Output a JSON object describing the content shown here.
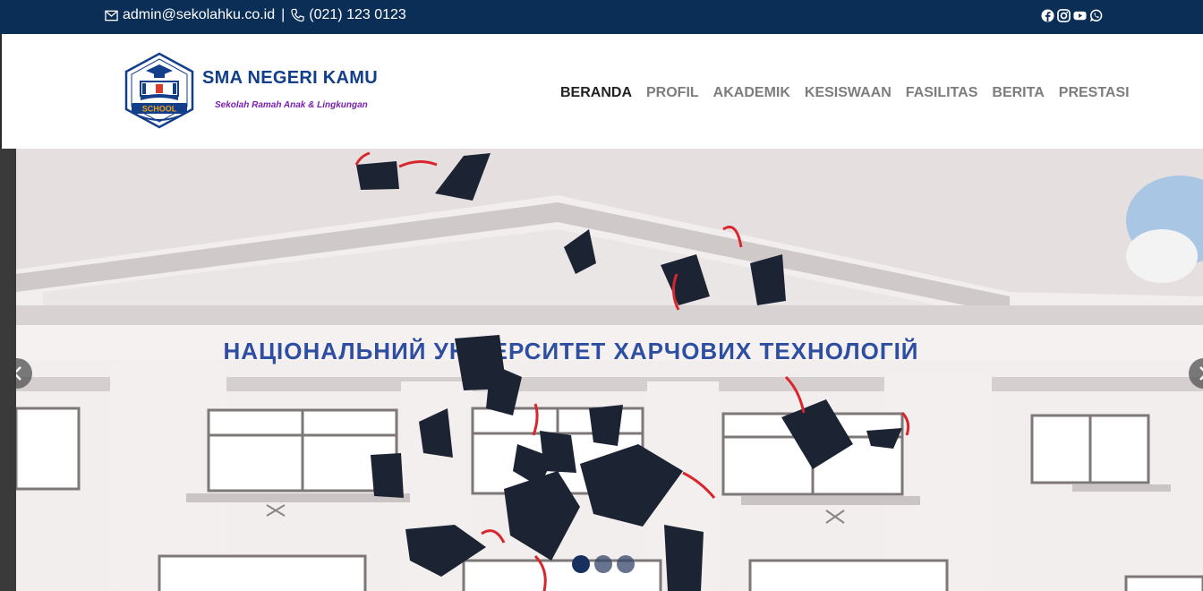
{
  "topbar": {
    "email": "admin@sekolahku.co.id",
    "separator": "|",
    "phone": "(021) 123 0123",
    "social_icons": [
      "facebook-icon",
      "instagram-icon",
      "youtube-icon",
      "whatsapp-icon"
    ]
  },
  "brand": {
    "name": "SMA NEGERI KAMU",
    "tagline": "Sekolah Ramah Anak & Lingkungan",
    "logo_text": "SCHOOL"
  },
  "nav": {
    "items": [
      {
        "label": "BERANDA",
        "active": true
      },
      {
        "label": "PROFIL",
        "active": false
      },
      {
        "label": "AKADEMIK",
        "active": false
      },
      {
        "label": "KESISWAAN",
        "active": false
      },
      {
        "label": "FASILITAS",
        "active": false
      },
      {
        "label": "BERITA",
        "active": false
      },
      {
        "label": "PRESTASI",
        "active": false
      }
    ]
  },
  "hero": {
    "building_sign": "НАЦІОНАЛЬНИЙ УНІВЕРСИТЕТ ХАРЧОВИХ ТЕХНОЛОГІЙ",
    "slides_total": 3,
    "active_slide": 1
  },
  "colors": {
    "topbar_bg": "#0b2e57",
    "brand_blue": "#123e8a",
    "tagline_purple": "#7a1fb0",
    "nav_active": "#222222",
    "nav_inactive": "#7d7d7d"
  }
}
